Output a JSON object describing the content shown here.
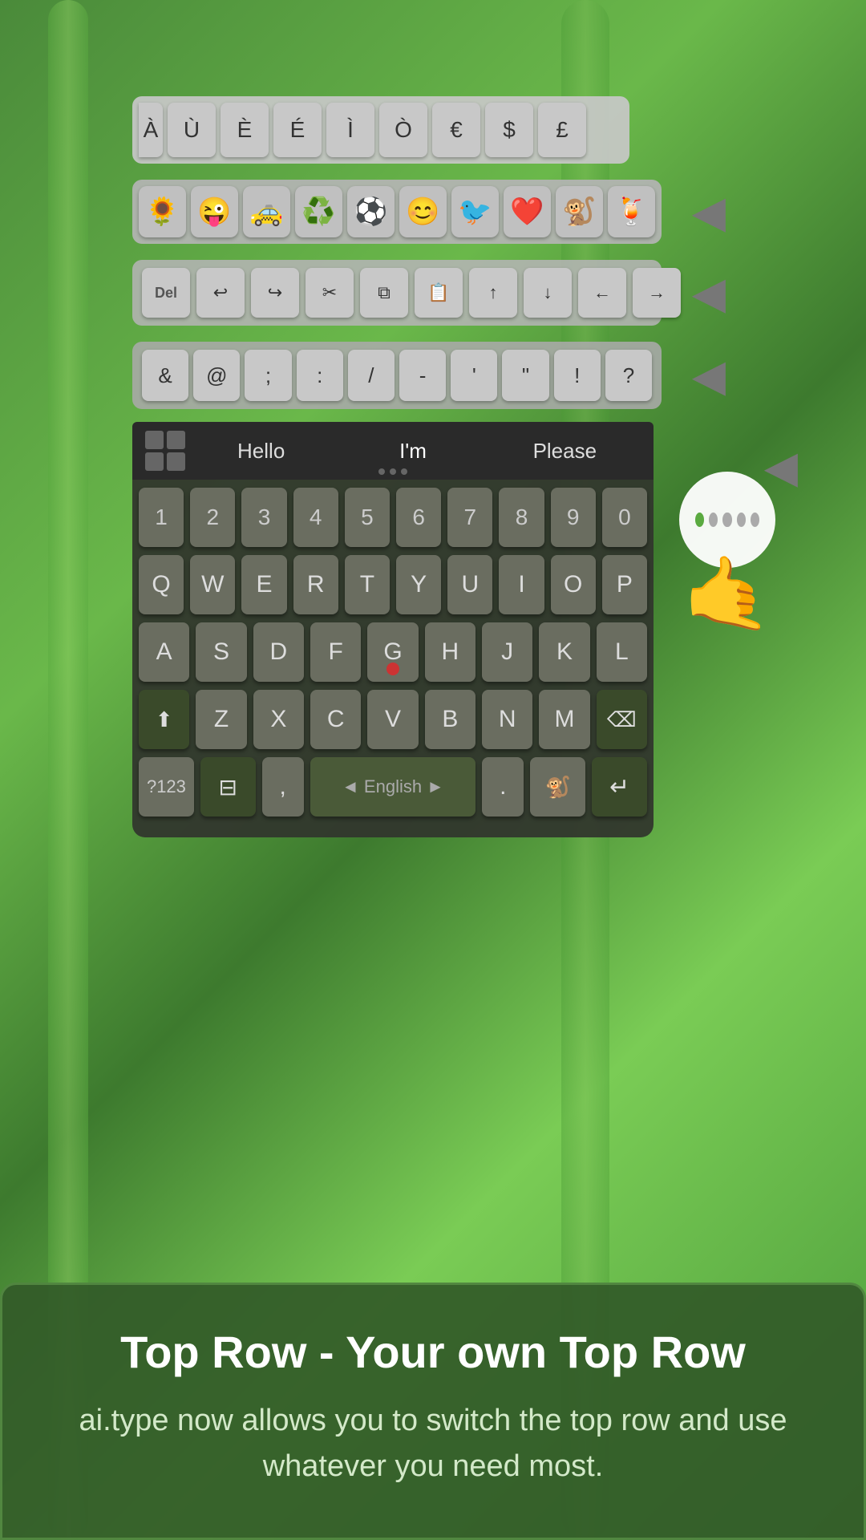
{
  "background": {
    "color_start": "#4a8a3a",
    "color_end": "#6ab84a"
  },
  "special_chars": {
    "keys": [
      "À",
      "Ù",
      "È",
      "É",
      "Ì",
      "Ò",
      "€",
      "$",
      "£"
    ]
  },
  "emoji_row": {
    "emojis": [
      "🌻",
      "😜",
      "🚕",
      "♻️",
      "⚽",
      "😊",
      "🐦",
      "❤️",
      "🐒",
      "🍹"
    ]
  },
  "edit_row": {
    "keys": [
      "Del",
      "↩",
      "↪",
      "✂",
      "⧉",
      "📋",
      "↑",
      "↓",
      "←",
      "→"
    ]
  },
  "symbols_row": {
    "keys": [
      "&",
      "@",
      ";",
      ":",
      "/",
      "-",
      "'",
      "\"",
      "!",
      "?"
    ]
  },
  "suggestions": {
    "items": [
      "Hello",
      "I'm",
      "Please"
    ]
  },
  "number_row": {
    "keys": [
      "1",
      "2",
      "3",
      "4",
      "5",
      "6",
      "7",
      "8",
      "9",
      "0"
    ]
  },
  "keyboard_rows": {
    "row1": [
      "Q",
      "W",
      "E",
      "R",
      "T",
      "Y",
      "U",
      "I",
      "O",
      "P"
    ],
    "row2": [
      "A",
      "S",
      "D",
      "F",
      "G",
      "H",
      "J",
      "K",
      "L"
    ],
    "row3": [
      "Z",
      "X",
      "C",
      "V",
      "B",
      "N",
      "M"
    ]
  },
  "bottom_row": {
    "num_key": "?123",
    "layout_key": "⊟",
    "comma": ",",
    "space_label": "◄ English ►",
    "period": ".",
    "emoji": "🐒",
    "enter": "↵"
  },
  "bottom_panel": {
    "title": "Top Row - Your own Top Row",
    "description": "ai.type now allows you to switch the top row\nand use whatever you need most."
  }
}
